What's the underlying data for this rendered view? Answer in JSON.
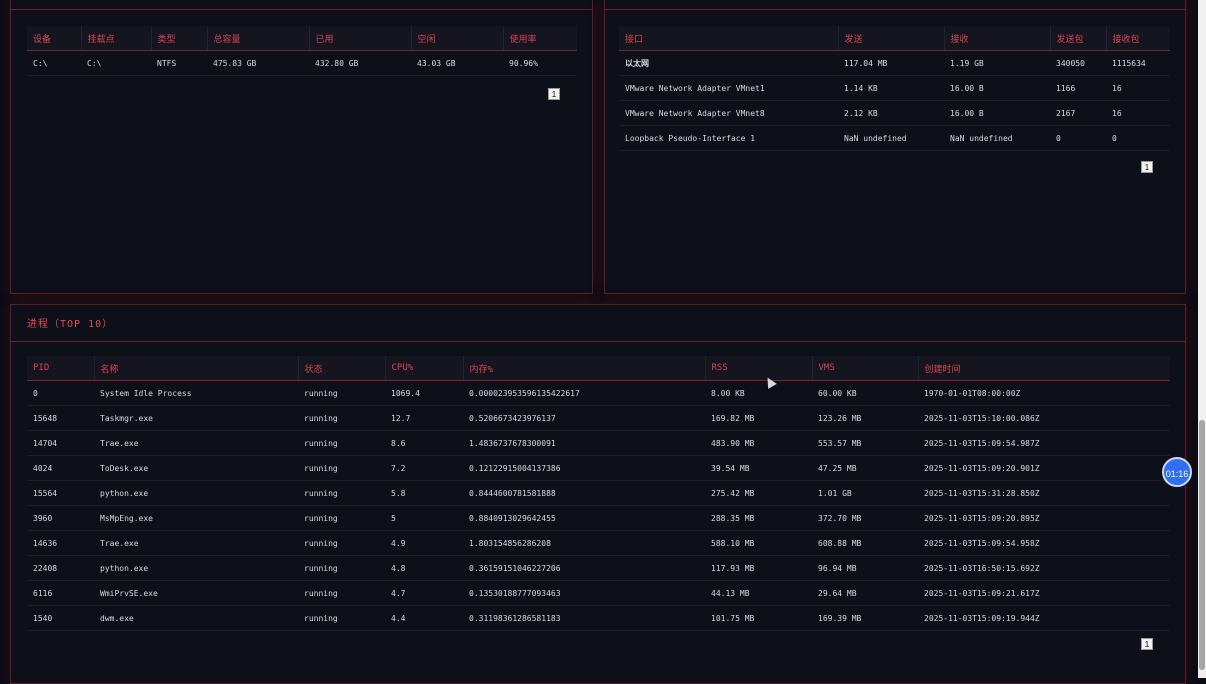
{
  "disk": {
    "headers": [
      "设备",
      "挂载点",
      "类型",
      "总容量",
      "已用",
      "空闲",
      "使用率"
    ],
    "rows": [
      [
        "C:\\",
        "C:\\",
        "NTFS",
        "475.83 GB",
        "432.80 GB",
        "43.03 GB",
        "90.96%"
      ]
    ],
    "page": "1"
  },
  "network": {
    "headers": [
      "接口",
      "发送",
      "接收",
      "发送包",
      "接收包"
    ],
    "rows": [
      [
        "以太网",
        "117.04 MB",
        "1.19 GB",
        "340050",
        "1115634"
      ],
      [
        "VMware Network Adapter VMnet1",
        "1.14 KB",
        "16.00 B",
        "1166",
        "16"
      ],
      [
        "VMware Network Adapter VMnet8",
        "2.12 KB",
        "16.00 B",
        "2167",
        "16"
      ],
      [
        "Loopback Pseudo-Interface 1",
        "NaN undefined",
        "NaN undefined",
        "0",
        "0"
      ]
    ],
    "page": "1"
  },
  "processes": {
    "title": "进程（TOP 10）",
    "headers": [
      "PID",
      "名称",
      "状态",
      "CPU%",
      "内存%",
      "RSS",
      "VMS",
      "创建时间"
    ],
    "rows": [
      [
        "0",
        "System Idle Process",
        "running",
        "1069.4",
        "0.00002395359613542261​7",
        "8.00 KB",
        "60.00 KB",
        "1970-01-01T08:00:00Z"
      ],
      [
        "15648",
        "Taskmgr.exe",
        "running",
        "12.7",
        "0.5206673423976137",
        "169.82 MB",
        "123.26 MB",
        "2025-11-03T15:10:00.086Z"
      ],
      [
        "14704",
        "Trae.exe",
        "running",
        "8.6",
        "1.4836737678300091",
        "483.90 MB",
        "553.57 MB",
        "2025-11-03T15:09:54.987Z"
      ],
      [
        "4024",
        "ToDesk.exe",
        "running",
        "7.2",
        "0.12122915004137386",
        "39.54 MB",
        "47.25 MB",
        "2025-11-03T15:09:20.901Z"
      ],
      [
        "15564",
        "python.exe",
        "running",
        "5.8",
        "0.8444600781581888",
        "275.42 MB",
        "1.01 GB",
        "2025-11-03T15:31:28.850Z"
      ],
      [
        "3960",
        "MsMpEng.exe",
        "running",
        "5",
        "0.8840913029642455",
        "288.35 MB",
        "372.70 MB",
        "2025-11-03T15:09:20.895Z"
      ],
      [
        "14636",
        "Trae.exe",
        "running",
        "4.9",
        "1.803154856286208",
        "588.10 MB",
        "608.88 MB",
        "2025-11-03T15:09:54.958Z"
      ],
      [
        "22408",
        "python.exe",
        "running",
        "4.8",
        "0.36159151046227206",
        "117.93 MB",
        "96.94 MB",
        "2025-11-03T16:50:15.692Z"
      ],
      [
        "6116",
        "WmiPrvSE.exe",
        "running",
        "4.7",
        "0.13530188777093463",
        "44.13 MB",
        "29.64 MB",
        "2025-11-03T15:09:21.617Z"
      ],
      [
        "1540",
        "dwm.exe",
        "running",
        "4.4",
        "0.31198361286581183",
        "101.75 MB",
        "169.39 MB",
        "2025-11-03T15:09:19.944Z"
      ]
    ],
    "page": "1"
  },
  "timer": "01:16"
}
